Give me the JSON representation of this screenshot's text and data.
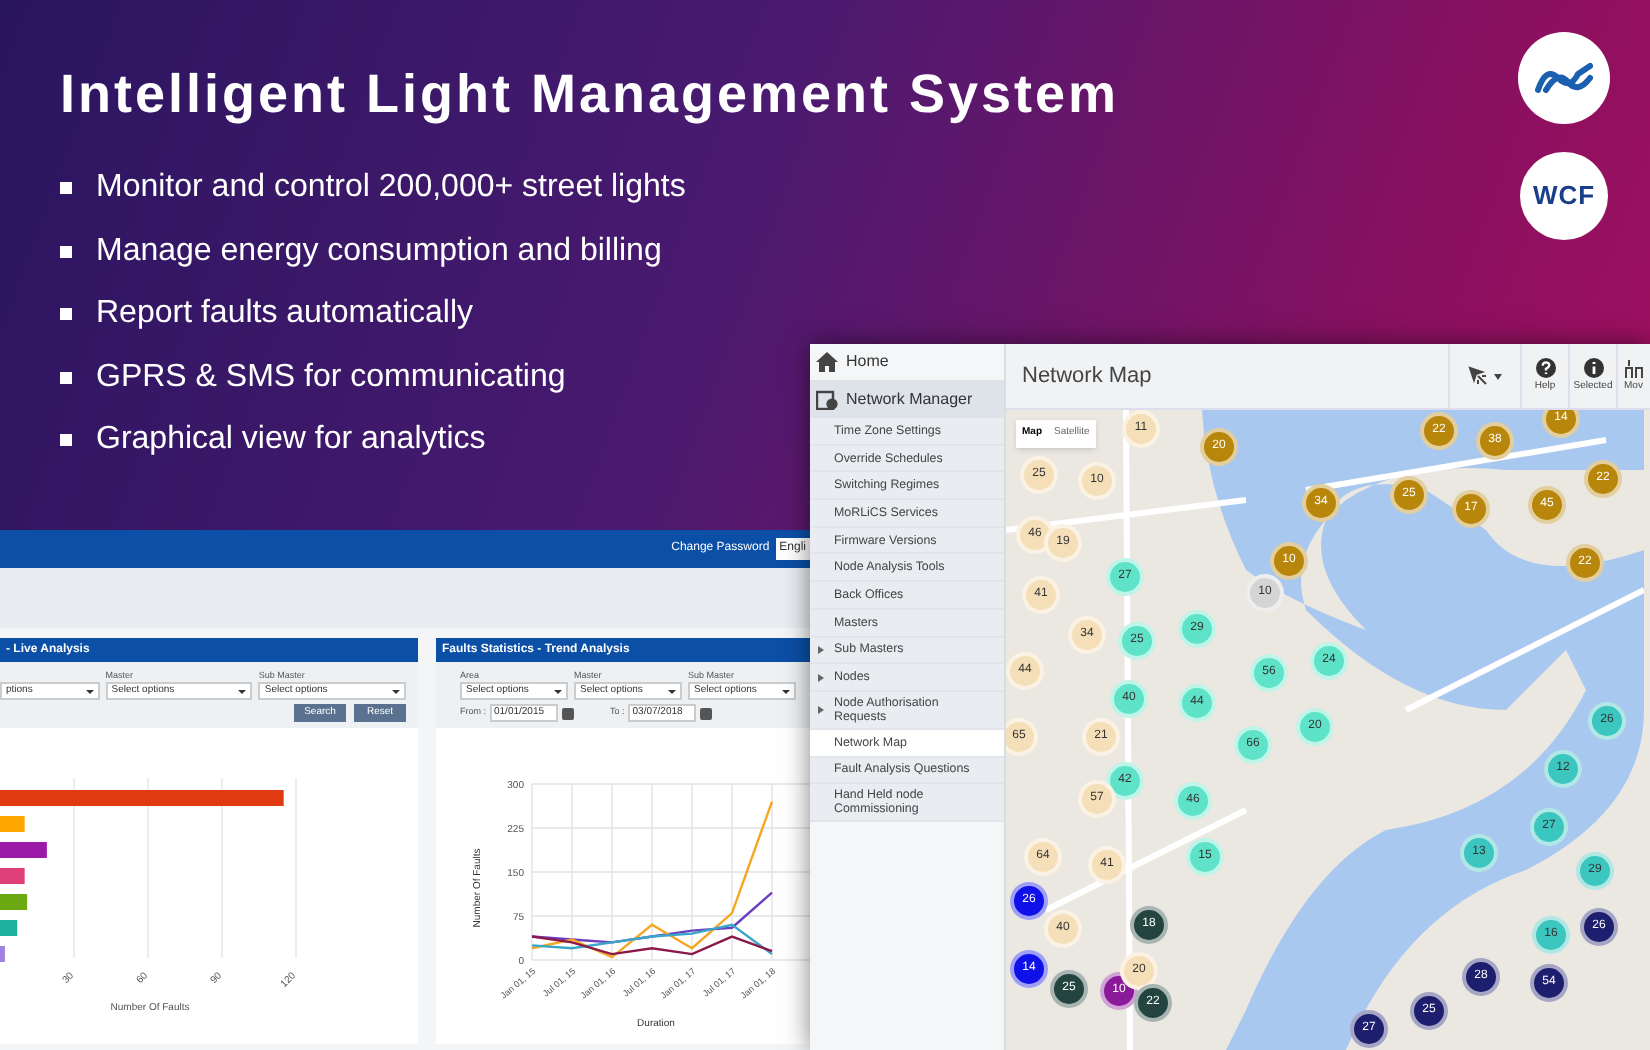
{
  "banner": {
    "title": "Intelligent Light Management System",
    "bullets": [
      "Monitor and control 200,000+ street lights",
      "Manage energy consumption and billing",
      "Report faults automatically",
      "GPRS & SMS for communicating",
      "Graphical view for analytics"
    ],
    "badges": [
      {
        "kind": "logo"
      },
      {
        "kind": "text",
        "label": "WCF"
      }
    ]
  },
  "dashboard": {
    "top_bar": {
      "link": "Change Password",
      "language": "Engli"
    },
    "panels": [
      {
        "title": "- Live Analysis",
        "filters": [
          {
            "value": "ptions"
          },
          {
            "label": "Master",
            "value": "Select options"
          },
          {
            "label": "Sub Master",
            "value": "Select options"
          }
        ],
        "buttons": [
          "Search",
          "Reset"
        ],
        "chart_data": {
          "type": "bar",
          "orientation": "horizontal",
          "grid": true,
          "xlabel": "Number Of Faults",
          "xlim": [
            0,
            120
          ],
          "xticks": [
            30,
            60,
            90,
            120
          ],
          "series": [
            {
              "color": "#e03a10",
              "values": [
                115,
                null,
                null,
                null,
                null,
                null,
                null
              ]
            },
            {
              "color": "#ffa500",
              "values": [
                null,
                10,
                null,
                null,
                null,
                null,
                null
              ]
            },
            {
              "color": "#9b1aa8",
              "values": [
                null,
                null,
                19,
                null,
                null,
                null,
                null
              ]
            },
            {
              "color": "#e0407a",
              "values": [
                null,
                null,
                null,
                10,
                null,
                null,
                null
              ]
            },
            {
              "color": "#6aaa10",
              "values": [
                null,
                null,
                null,
                null,
                11,
                null,
                null
              ]
            },
            {
              "color": "#20b0a0",
              "values": [
                null,
                null,
                null,
                null,
                null,
                7,
                null
              ]
            },
            {
              "color": "#a080e0",
              "values": [
                null,
                null,
                null,
                null,
                null,
                null,
                2
              ]
            }
          ]
        }
      },
      {
        "title": "Faults Statistics - Trend Analysis",
        "filters": [
          {
            "label": "Area",
            "value": "Select options"
          },
          {
            "label": "Master",
            "value": "Select options"
          },
          {
            "label": "Sub Master",
            "value": "Select options"
          }
        ],
        "dates": [
          {
            "label": "From :",
            "value": "01/01/2015"
          },
          {
            "label": "To :",
            "value": "03/07/2018"
          }
        ],
        "chart_data": {
          "type": "line",
          "grid": true,
          "xlabel": "Duration",
          "ylabel": "Number Of Faults",
          "ylim": [
            0,
            300
          ],
          "yticks": [
            0,
            75,
            150,
            225,
            300
          ],
          "categories": [
            "Jan 01, 15",
            "Jul 01, 15",
            "Jan 01, 16",
            "Jul 01, 16",
            "Jan 01, 17",
            "Jul 01, 17",
            "Jan 01, 18"
          ],
          "series": [
            {
              "color": "#6a3fc0",
              "values": [
                40,
                35,
                30,
                40,
                50,
                55,
                115
              ]
            },
            {
              "color": "#f5a623",
              "values": [
                20,
                35,
                5,
                60,
                20,
                80,
                270
              ]
            },
            {
              "color": "#3aa6c9",
              "values": [
                25,
                20,
                30,
                40,
                45,
                60,
                10
              ]
            },
            {
              "color": "#8b1a4a",
              "values": [
                40,
                30,
                10,
                20,
                10,
                40,
                15
              ]
            }
          ]
        }
      }
    ]
  },
  "network_app": {
    "sidebar": [
      {
        "label": "Home",
        "kind": "home"
      },
      {
        "label": "Network Manager",
        "kind": "section",
        "children": [
          {
            "label": "Time Zone Settings",
            "expandable": false,
            "selected": false
          },
          {
            "label": "Override Schedules",
            "expandable": false,
            "selected": false
          },
          {
            "label": "Switching Regimes",
            "expandable": false,
            "selected": false
          },
          {
            "label": "MoRLiCS Services",
            "expandable": false,
            "selected": false
          },
          {
            "label": "Firmware Versions",
            "expandable": false,
            "selected": false
          },
          {
            "label": "Node Analysis Tools",
            "expandable": false,
            "selected": false
          },
          {
            "label": "Back Offices",
            "expandable": false,
            "selected": false
          },
          {
            "label": "Masters",
            "expandable": false,
            "selected": false
          },
          {
            "label": "Sub Masters",
            "expandable": true,
            "selected": false
          },
          {
            "label": "Nodes",
            "expandable": true,
            "selected": false
          },
          {
            "label": "Node Authorisation Requests",
            "expandable": true,
            "selected": false
          },
          {
            "label": "Network Map",
            "expandable": false,
            "selected": true
          },
          {
            "label": "Fault Analysis Questions",
            "expandable": false,
            "selected": false
          },
          {
            "label": "Hand Held node Commissioning",
            "expandable": false,
            "selected": false
          }
        ]
      }
    ],
    "title": "Network Map",
    "toolbar": [
      {
        "kind": "pointer"
      },
      {
        "kind": "help",
        "label": "Help"
      },
      {
        "kind": "info",
        "label": "Selected"
      },
      {
        "kind": "move",
        "label": "Mov"
      }
    ],
    "map": {
      "type_toggle": [
        {
          "label": "Map",
          "selected": true
        },
        {
          "label": "Satellite",
          "selected": false
        }
      ],
      "markers": [
        {
          "label": "11",
          "color": "#f5dfb8"
        },
        {
          "label": "25",
          "color": "#f5dfb8"
        },
        {
          "label": "10",
          "color": "#f5dfb8"
        },
        {
          "label": "46",
          "color": "#f5dfb8"
        },
        {
          "label": "19",
          "color": "#f5dfb8"
        },
        {
          "label": "27",
          "color": "#5fe3c8"
        },
        {
          "label": "41",
          "color": "#f5dfb8"
        },
        {
          "label": "34",
          "color": "#f5dfb8"
        },
        {
          "label": "25",
          "color": "#5fe3c8"
        },
        {
          "label": "29",
          "color": "#5fe3c8"
        },
        {
          "label": "44",
          "color": "#f5dfb8"
        },
        {
          "label": "10",
          "color": "#d4d4d4"
        },
        {
          "label": "56",
          "color": "#5fe3c8"
        },
        {
          "label": "24",
          "color": "#5fe3c8"
        },
        {
          "label": "20",
          "color": "#b8860b"
        },
        {
          "label": "22",
          "color": "#b8860b"
        },
        {
          "label": "38",
          "color": "#b8860b"
        },
        {
          "label": "14",
          "color": "#b8860b"
        },
        {
          "label": "34",
          "color": "#b8860b"
        },
        {
          "label": "25",
          "color": "#b8860b"
        },
        {
          "label": "17",
          "color": "#b8860b"
        },
        {
          "label": "45",
          "color": "#b8860b"
        },
        {
          "label": "22",
          "color": "#b8860b"
        },
        {
          "label": "10",
          "color": "#b8860b"
        },
        {
          "label": "22",
          "color": "#b8860b"
        },
        {
          "label": "40",
          "color": "#5fe3c8"
        },
        {
          "label": "44",
          "color": "#5fe3c8"
        },
        {
          "label": "66",
          "color": "#5fe3c8"
        },
        {
          "label": "20",
          "color": "#5fe3c8"
        },
        {
          "label": "65",
          "color": "#f5dfb8"
        },
        {
          "label": "21",
          "color": "#f5dfb8"
        },
        {
          "label": "42",
          "color": "#5fe3c8"
        },
        {
          "label": "57",
          "color": "#f5dfb8"
        },
        {
          "label": "46",
          "color": "#5fe3c8"
        },
        {
          "label": "64",
          "color": "#f5dfb8"
        },
        {
          "label": "15",
          "color": "#5fe3c8"
        },
        {
          "label": "41",
          "color": "#f5dfb8"
        },
        {
          "label": "26",
          "color": "#1010e8"
        },
        {
          "label": "40",
          "color": "#f5dfb8"
        },
        {
          "label": "18",
          "color": "#24443f"
        },
        {
          "label": "14",
          "color": "#1010e8"
        },
        {
          "label": "25",
          "color": "#24443f"
        },
        {
          "label": "10",
          "color": "#8b1a9b"
        },
        {
          "label": "20",
          "color": "#f5dfb8"
        },
        {
          "label": "22",
          "color": "#24443f"
        },
        {
          "label": "26",
          "color": "#3cc6c0"
        },
        {
          "label": "12",
          "color": "#3cc6c0"
        },
        {
          "label": "27",
          "color": "#3cc6c0"
        },
        {
          "label": "13",
          "color": "#3cc6c0"
        },
        {
          "label": "29",
          "color": "#3cc6c0"
        },
        {
          "label": "16",
          "color": "#3cc6c0"
        },
        {
          "label": "26",
          "color": "#1e1e6e"
        },
        {
          "label": "28",
          "color": "#1e1e6e"
        },
        {
          "label": "54",
          "color": "#1e1e6e"
        },
        {
          "label": "25",
          "color": "#1e1e6e"
        },
        {
          "label": "27",
          "color": "#1e1e6e"
        }
      ]
    }
  }
}
